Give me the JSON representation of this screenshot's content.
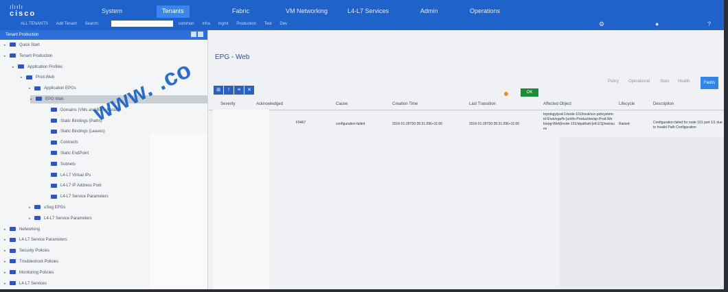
{
  "app": {
    "logo_text": "cisco",
    "logo_bars": "ılıılı"
  },
  "topbar": {
    "tabs": [
      "System",
      "Tenants",
      "Fabric",
      "VM Networking",
      "L4-L7 Services",
      "Admin",
      "Operations"
    ],
    "active_tab_index": 1,
    "subnav_crumbs": [
      "ALL TENANTS",
      "Add Tenant",
      "Search:"
    ],
    "search_value": "",
    "subnav_links": [
      "common",
      "infra",
      "mgmt",
      "Production",
      "Test",
      "Dev"
    ],
    "icons": [
      "gear-icon",
      "user-icon",
      "help-icon"
    ]
  },
  "left_pane": {
    "header_title": "Tenant Production",
    "tree": [
      {
        "label": "Quick Start",
        "indent": 0
      },
      {
        "label": "Tenant Production",
        "indent": 0
      },
      {
        "label": "Application Profiles",
        "indent": 1
      },
      {
        "label": "Prod-Web",
        "indent": 2
      },
      {
        "label": "Application EPGs",
        "indent": 3
      },
      {
        "label": "EPG Web",
        "indent": 4,
        "selected": true
      },
      {
        "label": "Domains (VMs and Bare-Metals)",
        "indent": 5
      },
      {
        "label": "Static Bindings (Paths)",
        "indent": 5
      },
      {
        "label": "Static Bindings (Leaves)",
        "indent": 5
      },
      {
        "label": "Contracts",
        "indent": 5
      },
      {
        "label": "Static EndPoint",
        "indent": 5
      },
      {
        "label": "Subnets",
        "indent": 5
      },
      {
        "label": "L4-L7 Virtual IPs",
        "indent": 5
      },
      {
        "label": "L4-L7 IP Address Pool",
        "indent": 5
      },
      {
        "label": "L4-L7 Service Parameters",
        "indent": 5
      },
      {
        "label": "uSeg EPGs",
        "indent": 3
      },
      {
        "label": "L4-L7 Service Parameters",
        "indent": 3
      },
      {
        "label": "Networking",
        "indent": 0
      },
      {
        "label": "L4-L7 Service Parameters",
        "indent": 0
      },
      {
        "label": "Security Policies",
        "indent": 0
      },
      {
        "label": "Troubleshoot Policies",
        "indent": 0
      },
      {
        "label": "Monitoring Policies",
        "indent": 0
      },
      {
        "label": "L4-L7 Services",
        "indent": 0
      }
    ]
  },
  "main": {
    "title": "EPG - Web",
    "toolbar_buttons": [
      "⊞",
      "!",
      "≡",
      "✕"
    ],
    "top_actions": [
      "Policy",
      "Operational",
      "Stats",
      "Health",
      "Faults"
    ],
    "submit_label": "Faults",
    "green_button": "OK",
    "columns": [
      "Severity",
      "Acknowledged",
      "Cause",
      "Creation Time",
      "Last Transition",
      "Affected Object",
      "Lifecycle",
      "Description"
    ],
    "rows": [
      {
        "severity": "",
        "acknowledged": "",
        "code": "F0467",
        "cause": "configuration-failed",
        "creation_time": "2016-01-29T20:35:31.096+11:00",
        "last_transition": "2016-01-29T20:35:31.096+11:00",
        "affected_object": "topology/pod-1/node-101/local/svc-policyelem-id-0/uni/epp/fv-[uni/tn-Production/ap-Prod-Web/epg-Web]/node-101/stpathatt-[eth1/1]/nwissues",
        "lifecycle": "Raised",
        "description": "Configuration failed for node 101 port 1/1 due to Invalid Path Configuration"
      }
    ]
  },
  "watermark": "www.   .co"
}
